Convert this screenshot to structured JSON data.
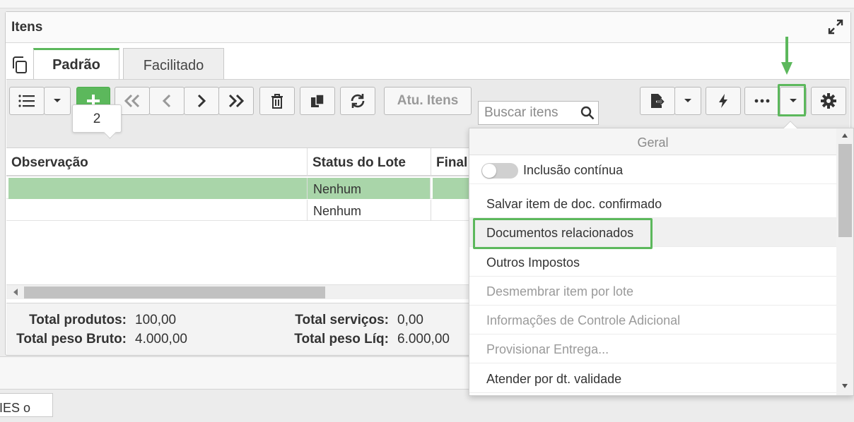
{
  "panel": {
    "title": "Itens"
  },
  "tabs": [
    {
      "label": "Padrão",
      "active": true
    },
    {
      "label": "Facilitado",
      "active": false
    }
  ],
  "toolbar": {
    "update_items_label": "Atu. Itens",
    "search_placeholder": "Buscar itens",
    "add_tooltip": "2"
  },
  "grid": {
    "columns": [
      "Observação",
      "Status do Lote",
      "Final"
    ],
    "rows": [
      {
        "observacao": "",
        "status_lote": "Nenhum",
        "selected": true
      },
      {
        "observacao": "",
        "status_lote": "Nenhum",
        "selected": false
      }
    ]
  },
  "totals": {
    "produtos_label": "Total produtos:",
    "produtos_value": "100,00",
    "servicos_label": "Total serviços:",
    "servicos_value": "0,00",
    "peso_bruto_label": "Total peso Bruto:",
    "peso_bruto_value": "4.000,00",
    "peso_liq_label": "Total peso Líq:",
    "peso_liq_value": "6.000,00"
  },
  "menu": {
    "header": "Geral",
    "items": [
      {
        "label": "Inclusão contínua",
        "type": "toggle",
        "checked": false
      },
      {
        "label": "Salvar item de doc. confirmado",
        "enabled": true
      },
      {
        "label": "Documentos relacionados",
        "enabled": true,
        "highlighted": true
      },
      {
        "label": "Outros Impostos",
        "enabled": true
      },
      {
        "label": "Desmembrar item por lote",
        "enabled": false
      },
      {
        "label": "Informações de Controle Adicional",
        "enabled": false
      },
      {
        "label": "Provisionar Entrega...",
        "enabled": false
      },
      {
        "label": "Atender por dt. validade",
        "enabled": true
      }
    ]
  },
  "bottom_tab": {
    "label": "IES o"
  },
  "colors": {
    "accent_green": "#5cb85c",
    "selected_row": "#a9d5a9",
    "arrow_green": "#5cb85c"
  }
}
